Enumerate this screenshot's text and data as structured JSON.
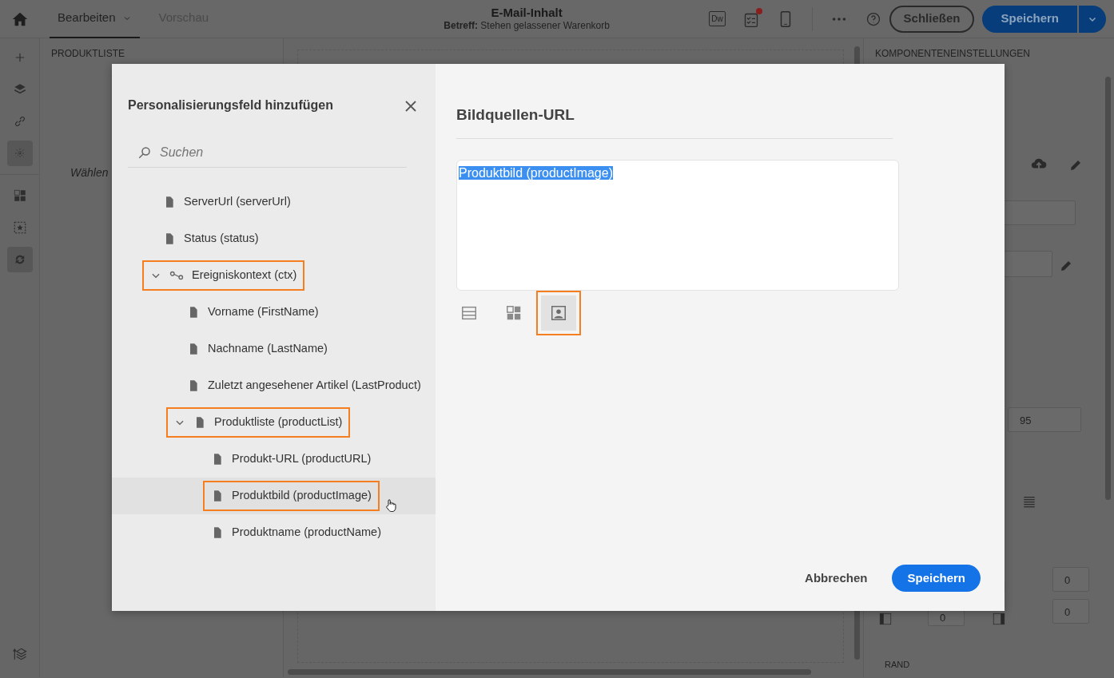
{
  "topbar": {
    "tabs": [
      {
        "label": "Bearbeiten",
        "selected": true,
        "has_menu": true
      },
      {
        "label": "Vorschau",
        "selected": false,
        "has_menu": false
      }
    ],
    "title": "E-Mail-Inhalt",
    "subject": "**Betreff:** Stehen gelassener Warenkorb",
    "dw_label": "Dw",
    "checklist_notification": true,
    "close_button": "Schließen",
    "save_button": "Speichern"
  },
  "rail": {
    "items": [
      {
        "kind": "plus",
        "selected": false
      },
      {
        "kind": "layers",
        "selected": false
      },
      {
        "kind": "link",
        "selected": false
      },
      {
        "kind": "fragments",
        "selected": true
      },
      {
        "kind": "grid",
        "selected": false
      },
      {
        "kind": "star",
        "selected": false
      },
      {
        "kind": "sync",
        "selected": true
      }
    ]
  },
  "left_panel": {
    "title": "PRODUKTLISTE",
    "hint": "Wählen"
  },
  "right_panel": {
    "title": "KOMPONENTENEINSTELLUNGEN",
    "width_value": "95",
    "spacing_values": [
      "0",
      "0",
      "0"
    ],
    "section": "RAND"
  },
  "modal": {
    "title": "Personalisierungsfeld hinzufügen",
    "search": {
      "placeholder": "Suchen"
    },
    "tree": [
      {
        "label": "ServerUrl (serverUrl)",
        "kind": "file",
        "highlighted": false,
        "hovered": false
      },
      {
        "label": "Status (status)",
        "kind": "file",
        "highlighted": false,
        "hovered": false
      },
      {
        "label": "Ereigniskontext (ctx)",
        "kind": "group",
        "highlighted": true,
        "hovered": false,
        "expanded": true,
        "children": [
          {
            "label": "Vorname (FirstName)",
            "kind": "file",
            "highlighted": false,
            "hovered": false
          },
          {
            "label": "Nachname (LastName)",
            "kind": "file",
            "highlighted": false,
            "hovered": false
          },
          {
            "label": "Zuletzt angesehener Artikel (LastProduct)",
            "kind": "file",
            "highlighted": false,
            "hovered": false
          },
          {
            "label": "Produktliste (productList)",
            "kind": "file",
            "highlighted": true,
            "hovered": false,
            "expanded": true,
            "children": [
              {
                "label": "Produkt-URL (productURL)",
                "kind": "file",
                "highlighted": false,
                "hovered": false
              },
              {
                "label": "Produktbild (productImage)",
                "kind": "file",
                "highlighted": true,
                "hovered": true
              },
              {
                "label": "Produktname (productName)",
                "kind": "file",
                "highlighted": false,
                "hovered": false
              }
            ]
          }
        ]
      }
    ],
    "heading": "Bildquellen-URL",
    "value": "Produktbild (productImage)",
    "value_selected": true,
    "modes": [
      {
        "kind": "layout",
        "selected": false,
        "highlighted": false
      },
      {
        "kind": "grid",
        "selected": false,
        "highlighted": false
      },
      {
        "kind": "image",
        "selected": true,
        "highlighted": true
      }
    ],
    "cancel_button": "Abbrechen",
    "save_button": "Speichern"
  }
}
